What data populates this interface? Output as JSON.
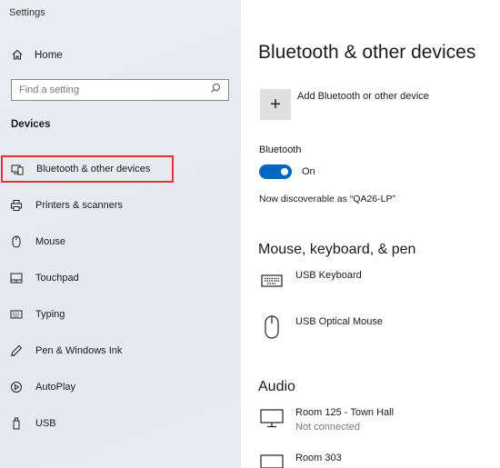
{
  "window": {
    "title": "Settings"
  },
  "sidebar": {
    "home_label": "Home",
    "search_placeholder": "Find a setting",
    "section_label": "Devices",
    "items": [
      {
        "label": "Bluetooth & other devices",
        "icon": "bluetooth-devices-icon",
        "selected": true
      },
      {
        "label": "Printers & scanners",
        "icon": "printer-icon"
      },
      {
        "label": "Mouse",
        "icon": "mouse-icon"
      },
      {
        "label": "Touchpad",
        "icon": "touchpad-icon"
      },
      {
        "label": "Typing",
        "icon": "keyboard-icon"
      },
      {
        "label": "Pen & Windows Ink",
        "icon": "pen-icon"
      },
      {
        "label": "AutoPlay",
        "icon": "autoplay-icon"
      },
      {
        "label": "USB",
        "icon": "usb-icon"
      }
    ]
  },
  "main": {
    "title": "Bluetooth & other devices",
    "add_device_label": "Add Bluetooth or other device",
    "bluetooth": {
      "heading": "Bluetooth",
      "toggle_on": true,
      "state_label": "On",
      "discoverable_text": "Now discoverable as “QA26-LP”"
    },
    "groups": [
      {
        "title": "Mouse, keyboard, & pen",
        "devices": [
          {
            "name": "USB Keyboard",
            "icon": "keyboard-icon"
          },
          {
            "name": "USB Optical Mouse",
            "icon": "mouse-icon"
          }
        ]
      },
      {
        "title": "Audio",
        "devices": [
          {
            "name": "Room 125 - Town Hall",
            "status": "Not connected",
            "icon": "monitor-icon"
          },
          {
            "name": "Room 303",
            "icon": "monitor-icon"
          }
        ]
      }
    ]
  },
  "colors": {
    "accent": "#0067c0",
    "highlight_border": "#e0313b",
    "sidebar_bg": "#e9eaf0"
  }
}
